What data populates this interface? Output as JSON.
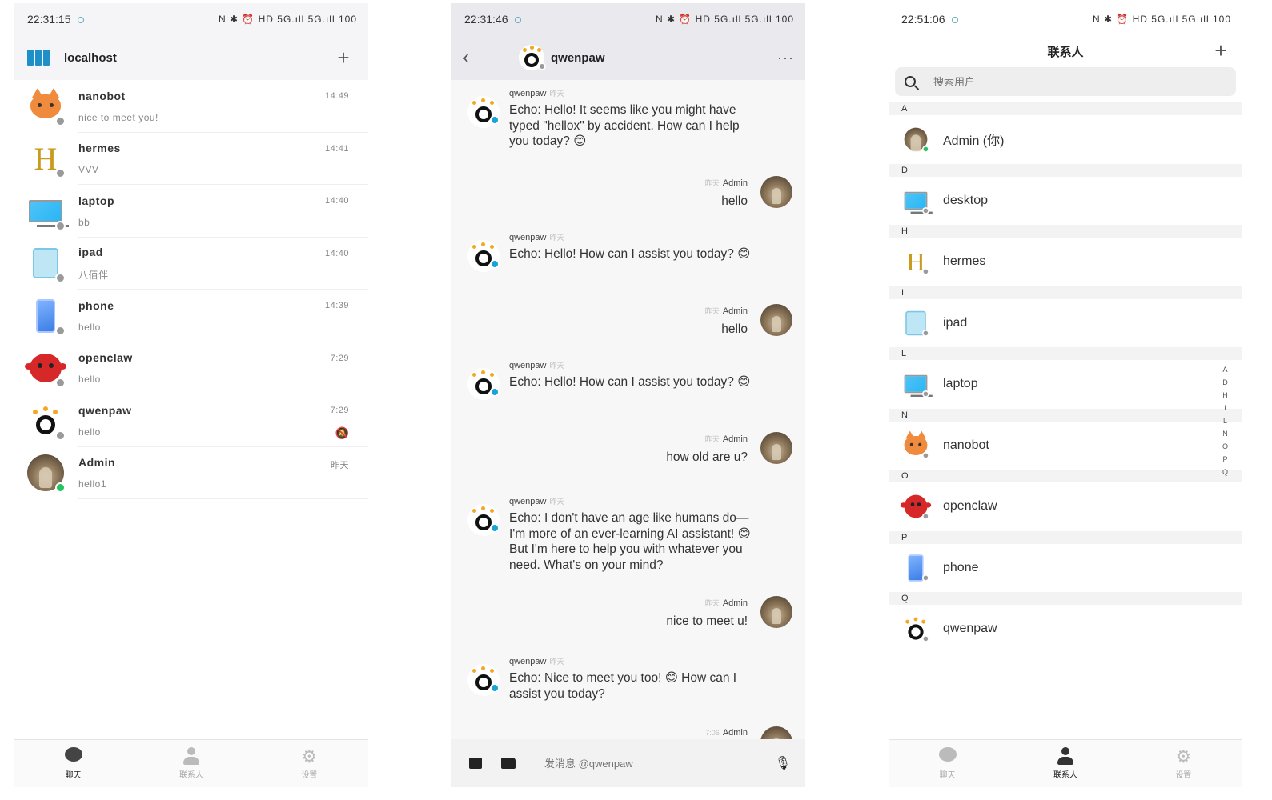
{
  "screen1": {
    "status_time": "22:31:15",
    "status_icons": "N ✱ ⏰ HD 5G.ıll 5G.ıll 100",
    "header_title": "localhost",
    "chats": [
      {
        "name": "nanobot",
        "preview": "nice to meet you!",
        "time": "14:49",
        "avatar": "cat-icon",
        "online": false
      },
      {
        "name": "hermes",
        "preview": "VVV",
        "time": "14:41",
        "avatar": "h-letter-icon",
        "online": false
      },
      {
        "name": "laptop",
        "preview": "bb",
        "time": "14:40",
        "avatar": "laptop-icon",
        "online": false
      },
      {
        "name": "ipad",
        "preview": "八佰伴",
        "time": "14:40",
        "avatar": "ipad-icon",
        "online": false
      },
      {
        "name": "phone",
        "preview": "hello",
        "time": "14:39",
        "avatar": "phone-icon",
        "online": false
      },
      {
        "name": "openclaw",
        "preview": "hello",
        "time": "7:29",
        "avatar": "claw-icon",
        "online": false
      },
      {
        "name": "qwenpaw",
        "preview": "hello",
        "time": "7:29",
        "avatar": "paw-icon",
        "online": false,
        "muted": true
      },
      {
        "name": "Admin",
        "preview": "hello1",
        "time": "昨天",
        "avatar": "admin-photo",
        "online": true
      }
    ]
  },
  "nav": {
    "chats": "聊天",
    "contacts": "联系人",
    "settings": "设置"
  },
  "screen2": {
    "status_time": "22:31:46",
    "status_icons": "N ✱ ⏰ HD 5G.ıll 5G.ıll 100",
    "header_title": "qwenpaw",
    "more": "···",
    "input_placeholder": "发消息 @qwenpaw",
    "messages": [
      {
        "dir": "in",
        "sender": "qwenpaw",
        "time": "昨天",
        "text": "Echo: Hello! It seems like you might have typed \"hellox\" by accident. How can I help you today? 😊"
      },
      {
        "dir": "out",
        "sender": "Admin",
        "time": "昨天",
        "text": "hello"
      },
      {
        "dir": "in",
        "sender": "qwenpaw",
        "time": "昨天",
        "text": "Echo: Hello! How can I assist you today? 😊"
      },
      {
        "dir": "out",
        "sender": "Admin",
        "time": "昨天",
        "text": "hello"
      },
      {
        "dir": "in",
        "sender": "qwenpaw",
        "time": "昨天",
        "text": "Echo: Hello! How can I assist you today? 😊"
      },
      {
        "dir": "out",
        "sender": "Admin",
        "time": "昨天",
        "text": "how old are u?"
      },
      {
        "dir": "in",
        "sender": "qwenpaw",
        "time": "昨天",
        "text": "Echo: I don't have an age like humans do—I'm more of an ever-learning AI assistant! 😊 But I'm here to help you with whatever you need. What's on your mind?"
      },
      {
        "dir": "out",
        "sender": "Admin",
        "time": "昨天",
        "text": "nice to meet u!"
      },
      {
        "dir": "in",
        "sender": "qwenpaw",
        "time": "昨天",
        "text": "Echo: Nice to meet you too! 😊 How can I assist you today?"
      },
      {
        "dir": "out",
        "sender": "Admin",
        "time": "7:06",
        "text": ""
      }
    ]
  },
  "screen3": {
    "status_time": "22:51:06",
    "status_icons": "N ✱ ⏰ HD 5G.ıll 5G.ıll 100",
    "header_title": "联系人",
    "search_placeholder": "搜索用户",
    "sections": [
      {
        "letter": "A",
        "contacts": [
          {
            "name": "Admin (你)",
            "avatar": "admin-photo",
            "online": true
          }
        ]
      },
      {
        "letter": "D",
        "contacts": [
          {
            "name": "desktop",
            "avatar": "laptop-icon",
            "online": false
          }
        ]
      },
      {
        "letter": "H",
        "contacts": [
          {
            "name": "hermes",
            "avatar": "h-letter-icon",
            "online": false
          }
        ]
      },
      {
        "letter": "I",
        "contacts": [
          {
            "name": "ipad",
            "avatar": "ipad-icon",
            "online": false
          }
        ]
      },
      {
        "letter": "L",
        "contacts": [
          {
            "name": "laptop",
            "avatar": "laptop-icon",
            "online": false
          }
        ]
      },
      {
        "letter": "N",
        "contacts": [
          {
            "name": "nanobot",
            "avatar": "cat-icon",
            "online": false
          }
        ]
      },
      {
        "letter": "O",
        "contacts": [
          {
            "name": "openclaw",
            "avatar": "claw-icon",
            "online": false
          }
        ]
      },
      {
        "letter": "P",
        "contacts": [
          {
            "name": "phone",
            "avatar": "phone-icon",
            "online": false
          }
        ]
      },
      {
        "letter": "Q",
        "contacts": [
          {
            "name": "qwenpaw",
            "avatar": "paw-icon",
            "online": false
          }
        ]
      }
    ],
    "alpha_index": [
      "A",
      "D",
      "H",
      "I",
      "L",
      "N",
      "O",
      "P",
      "Q"
    ]
  },
  "colors": {
    "online": "#22c55e",
    "offline": "#9a9a9a",
    "accent_badge": "#1aa3d9"
  }
}
